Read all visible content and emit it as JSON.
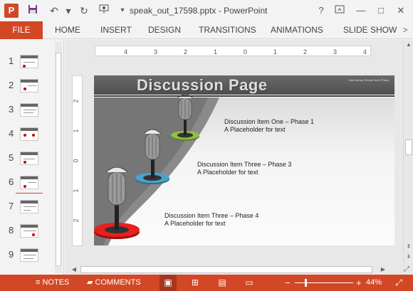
{
  "titlebar": {
    "app_icon": "powerpoint-icon",
    "save_icon": "save-icon",
    "undo_icon": "undo-icon",
    "redo_icon": "redo-icon",
    "present_icon": "present-from-beginning-icon",
    "customize_icon": "customize-qat-icon",
    "title": "speak_out_17598.pptx - PowerPoint",
    "help": "?",
    "ribbon_display_icon": "ribbon-display-options-icon",
    "minimize": "—",
    "restore": "□",
    "close": "✕"
  },
  "ribbon": {
    "file": "FILE",
    "tabs": [
      "HOME",
      "INSERT",
      "DESIGN",
      "TRANSITIONS",
      "ANIMATIONS",
      "SLIDE SHOW"
    ],
    "collapse": ">"
  },
  "thumbnails": [
    "1",
    "2",
    "3",
    "4",
    "5",
    "6",
    "7",
    "8",
    "9"
  ],
  "ruler": {
    "h_ticks": [
      "4",
      "3",
      "2",
      "1",
      "0",
      "1",
      "2",
      "3",
      "4"
    ],
    "v_ticks": [
      "2",
      "1",
      "0",
      "1",
      "2"
    ]
  },
  "slide": {
    "title": "Discussion Page",
    "header_sub": "Click Mouse Reveal Next Phase",
    "items": [
      {
        "line1": "Discussion Item One – Phase 1",
        "line2": "A Placeholder for text"
      },
      {
        "line1": "Discussion Item Three – Phase 3",
        "line2": "A Placeholder for text"
      },
      {
        "line1": "Discussion Item Three – Phase 4",
        "line2": "A Placeholder for text"
      }
    ],
    "colors": {
      "ring_green": "#7aa33a",
      "ring_blue": "#3d8fb5",
      "ring_red": "#e02020"
    }
  },
  "status": {
    "notes": "NOTES",
    "comments": "COMMENTS",
    "zoom_minus": "−",
    "zoom_plus": "+",
    "zoom": "44%",
    "zoom_fraction": 0.44
  }
}
